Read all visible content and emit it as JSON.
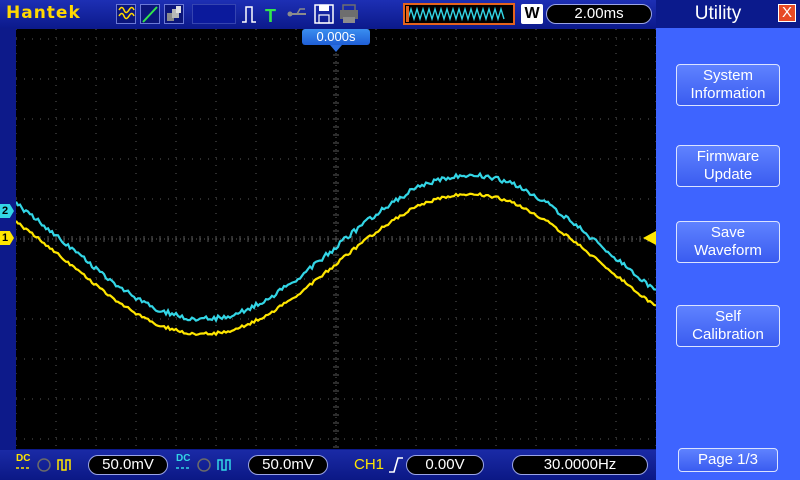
{
  "header": {
    "brand": "Hantek",
    "w_badge": "W",
    "timebase": "2.00ms"
  },
  "screen": {
    "trigger_position": "0.000s",
    "ch2_marker": "2",
    "ch1_marker": "1"
  },
  "footer": {
    "ch1_coupling": "DC",
    "ch1_volts_div": "50.0mV",
    "ch2_coupling": "DC",
    "ch2_volts_div": "50.0mV",
    "trigger_source": "CH1",
    "trigger_level": "0.00V",
    "frequency": "30.0000Hz"
  },
  "menu": {
    "title": "Utility",
    "close_glyph": "X",
    "buttons": [
      {
        "line1": "System",
        "line2": "Information"
      },
      {
        "line1": "Firmware",
        "line2": "Update"
      },
      {
        "line1": "Save",
        "line2": "Waveform"
      },
      {
        "line1": "Self",
        "line2": "Calibration"
      }
    ],
    "page": "Page 1/3"
  },
  "colors": {
    "ch1": "#ffe600",
    "ch2": "#33d6e6",
    "grid": "#5a5a5a",
    "background": "#000000",
    "menu": "#3e64ff",
    "header": "#0d1a8a"
  }
}
